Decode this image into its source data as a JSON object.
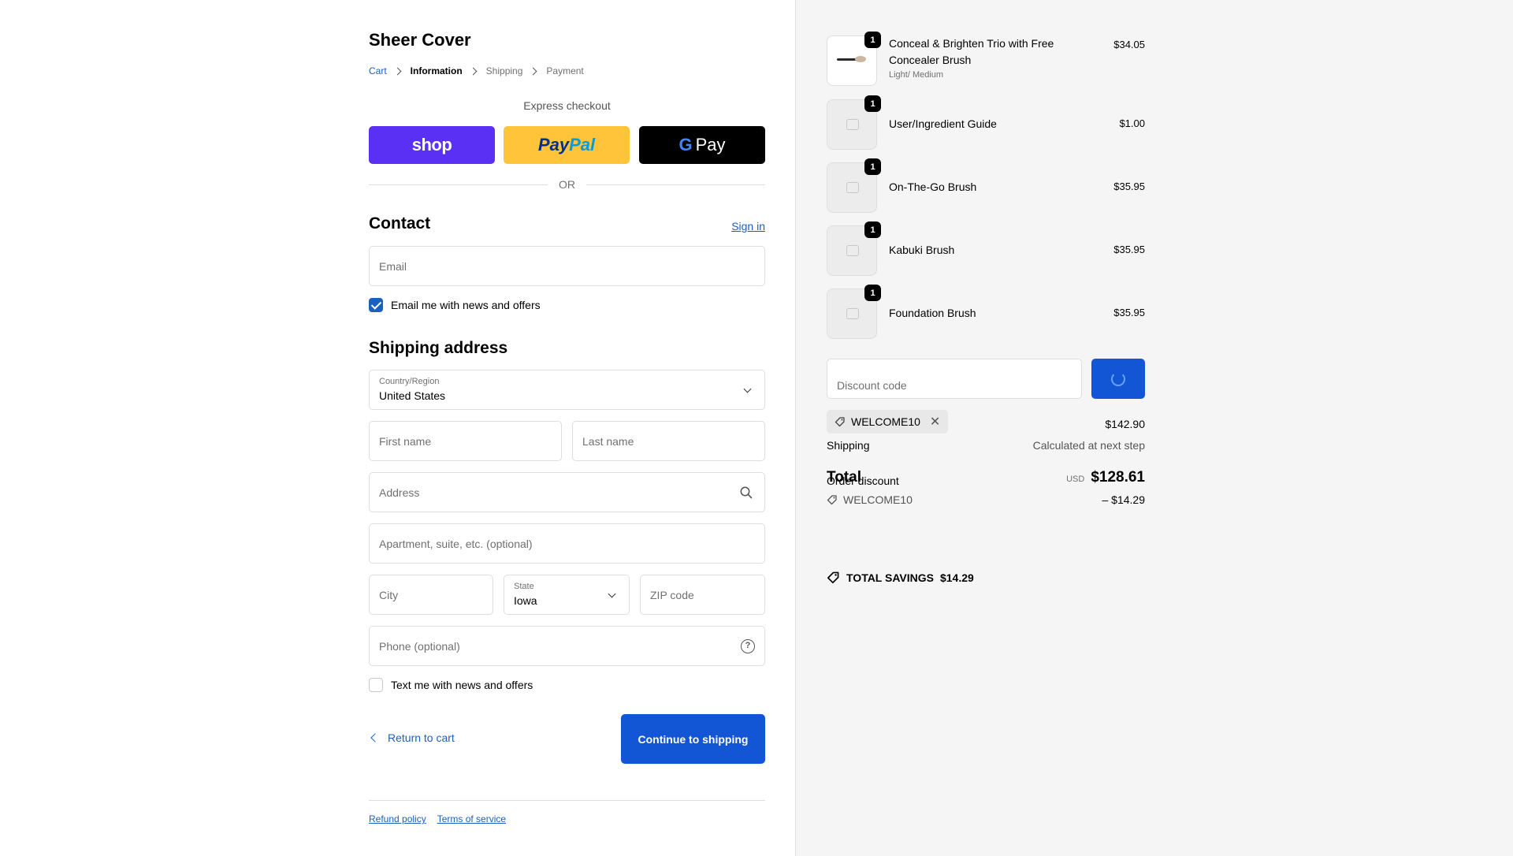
{
  "shop": {
    "name": "Sheer Cover"
  },
  "breadcrumb": [
    {
      "label": "Cart"
    },
    {
      "label": "Information"
    },
    {
      "label": "Shipping"
    },
    {
      "label": "Payment"
    }
  ],
  "express": {
    "label": "Express checkout",
    "shop_pay": "shop",
    "paypal_1": "Pay",
    "paypal_2": "Pal",
    "gpay_g": "G",
    "gpay_text": "Pay",
    "or": "OR"
  },
  "contact": {
    "title": "Contact",
    "signin": "Sign in",
    "email_placeholder": "Email",
    "news_label": "Email me with news and offers",
    "news_checked": true
  },
  "shipping": {
    "title": "Shipping address",
    "country_label": "Country/Region",
    "country_value": "United States",
    "first_name_placeholder": "First name",
    "last_name_placeholder": "Last name",
    "address_placeholder": "Address",
    "apartment_placeholder": "Apartment, suite, etc. (optional)",
    "city_placeholder": "City",
    "state_label": "State",
    "state_value": "Iowa",
    "zip_placeholder": "ZIP code",
    "phone_placeholder": "Phone (optional)",
    "help_glyph": "?",
    "text_label": "Text me with news and offers",
    "text_checked": false
  },
  "actions": {
    "return_label": "Return to cart",
    "continue_label": "Continue to shipping"
  },
  "footer": {
    "refund": "Refund policy",
    "terms": "Terms of service"
  },
  "cart": {
    "items": [
      {
        "title": "Conceal & Brighten Trio with Free Concealer Brush",
        "variant": "Light/ Medium",
        "price": "$34.05",
        "qty": "1"
      },
      {
        "title": "User/Ingredient Guide",
        "variant": "",
        "price": "$1.00",
        "qty": "1"
      },
      {
        "title": "On-The-Go Brush",
        "variant": "",
        "price": "$35.95",
        "qty": "1"
      },
      {
        "title": "Kabuki Brush",
        "variant": "",
        "price": "$35.95",
        "qty": "1"
      },
      {
        "title": "Foundation Brush",
        "variant": "",
        "price": "$35.95",
        "qty": "1"
      }
    ],
    "discount_placeholder": "Discount code",
    "applied_code": "WELCOME10",
    "remove_glyph": "✕",
    "subtotal_value": "$142.90",
    "shipping_label": "Shipping",
    "shipping_value": "Calculated at next step",
    "order_discount_label": "Order discount",
    "discount_code": "WELCOME10",
    "discount_value": "– $14.29",
    "total_label": "Total",
    "total_currency": "USD",
    "total_value": "$128.61",
    "savings_label": "TOTAL SAVINGS",
    "savings_value": "$14.29"
  },
  "colors": {
    "accent": "#1256d6",
    "link": "#1b5fbf",
    "shop_pay": "#5a31f4",
    "paypal": "#ffc439",
    "sidebar_bg": "#f5f5f5"
  },
  "icons": {
    "breadcrumb_separator": "chevron-right-icon",
    "country_select": "chevron-down-icon",
    "address_search": "search-icon",
    "phone_help": "help-circle-icon",
    "return": "chevron-left-icon",
    "discount_tag": "tag-icon",
    "remove_code": "close-icon",
    "apply_loading": "spinner-icon",
    "savings": "tag-icon",
    "item_placeholder": "image-placeholder-icon"
  }
}
